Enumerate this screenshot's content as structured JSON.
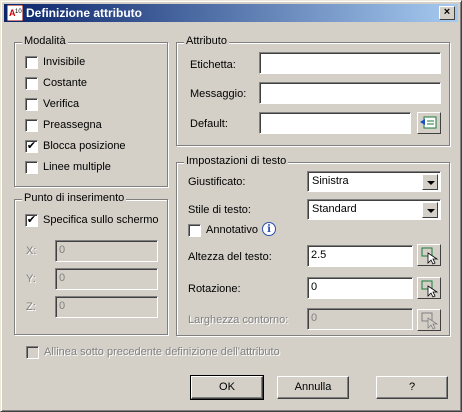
{
  "window": {
    "title": "Definizione attributo",
    "close_glyph": "×"
  },
  "modalita": {
    "legend": "Modalità",
    "items": [
      {
        "label": "Invisibile",
        "checked": false
      },
      {
        "label": "Costante",
        "checked": false
      },
      {
        "label": "Verifica",
        "checked": false
      },
      {
        "label": "Preassegna",
        "checked": false
      },
      {
        "label": "Blocca posizione",
        "checked": true
      },
      {
        "label": "Linee multiple",
        "checked": false
      }
    ]
  },
  "insert_point": {
    "legend": "Punto di inserimento",
    "on_screen_label": "Specifica sullo schermo",
    "on_screen_checked": true,
    "x_label": "X:",
    "x_value": "0",
    "y_label": "Y:",
    "y_value": "0",
    "z_label": "Z:",
    "z_value": "0"
  },
  "attribute": {
    "legend": "Attributo",
    "tag_label": "Etichetta:",
    "tag_value": "",
    "prompt_label": "Messaggio:",
    "prompt_value": "",
    "default_label": "Default:",
    "default_value": ""
  },
  "text_settings": {
    "legend": "Impostazioni di testo",
    "justify_label": "Giustificato:",
    "justify_value": "Sinistra",
    "style_label": "Stile di testo:",
    "style_value": "Standard",
    "annotative_label": "Annotativo",
    "annotative_checked": false,
    "height_label": "Altezza del testo:",
    "height_value": "2.5",
    "rotation_label": "Rotazione:",
    "rotation_value": "0",
    "boundary_label": "Larghezza contorno:",
    "boundary_value": "0"
  },
  "align_below": {
    "label": "Allinea sotto precedente definizione dell'attributo",
    "checked": false
  },
  "buttons": {
    "ok": "OK",
    "cancel": "Annulla",
    "help": "?"
  },
  "icons": {
    "app": "autocad-app-icon",
    "field": "insert-field-icon",
    "pick": "pick-point-icon",
    "info": "info-icon"
  }
}
